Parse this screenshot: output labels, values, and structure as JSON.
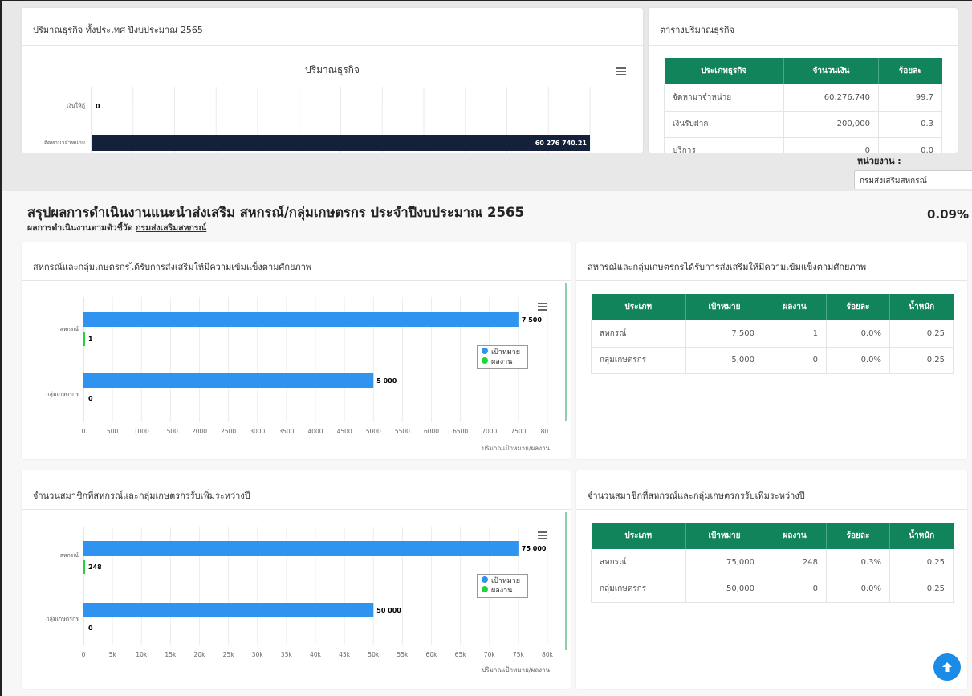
{
  "top_left_card": {
    "title": "ปริมาณธุรกิจ ทั้งประเทศ ปีงบประมาณ 2565",
    "chart_title": "ปริมาณธุรกิจ"
  },
  "top_right_card": {
    "title": "ตารางปริมาณธุรกิจ",
    "headers": [
      "ประเภทธุรกิจ",
      "จำนวนเงิน",
      "ร้อยละ"
    ],
    "rows": [
      [
        "จัดหามาจำหน่าย",
        "60,276,740",
        "99.7"
      ],
      [
        "เงินรับฝาก",
        "200,000",
        "0.3"
      ],
      [
        "บริการ",
        "0",
        "0.0"
      ]
    ]
  },
  "filter": {
    "unit_label": "หน่วยงาน :",
    "unit_value": "กรมส่งเสริมสหกรณ์"
  },
  "summary": {
    "title": "สรุปผลการดำเนินงานแนะนำส่งเสริม สหกรณ์/กลุ่มเกษตรกร ประจำปีงบประมาณ 2565",
    "subtitle_prefix": "ผลการดำเนินงานตามตัวชี้วัด",
    "subtitle_link": "กรมส่งเสริมสหกรณ์",
    "percent": "0.09%"
  },
  "section1": {
    "title_left": "สหกรณ์และกลุ่มเกษตรกรได้รับการส่งเสริมให้มีความเข้มแข็งตามศักยภาพ",
    "title_right": "สหกรณ์และกลุ่มเกษตรกรได้รับการส่งเสริมให้มีความเข้มแข็งตามศักยภาพ",
    "table_headers": [
      "ประเภท",
      "เป้าหมาย",
      "ผลงาน",
      "ร้อยละ",
      "น้ำหนัก"
    ],
    "table_rows": [
      [
        "สหกรณ์",
        "7,500",
        "1",
        "0.0%",
        "0.25"
      ],
      [
        "กลุ่มเกษตรกร",
        "5,000",
        "0",
        "0.0%",
        "0.25"
      ]
    ]
  },
  "section2": {
    "title_left": "จำนวนสมาชิกที่สหกรณ์และกลุ่มเกษตรกรรับเพิ่มระหว่างปี",
    "title_right": "จำนวนสมาชิกที่สหกรณ์และกลุ่มเกษตรกรรับเพิ่มระหว่างปี",
    "table_headers": [
      "ประเภท",
      "เป้าหมาย",
      "ผลงาน",
      "ร้อยละ",
      "น้ำหนัก"
    ],
    "table_rows": [
      [
        "สหกรณ์",
        "75,000",
        "248",
        "0.3%",
        "0.25"
      ],
      [
        "กลุ่มเกษตรกร",
        "50,000",
        "0",
        "0.0%",
        "0.25"
      ]
    ]
  },
  "chart_data": [
    {
      "type": "bar",
      "orientation": "horizontal",
      "title": "ปริมาณธุรกิจ",
      "categories": [
        "เงินให้กู้",
        "จัดหามาจำหน่าย"
      ],
      "series": [
        {
          "values": [
            0,
            60276740.21
          ]
        }
      ],
      "value_labels": [
        "0",
        "60 276 740.21"
      ],
      "color": "#15213a",
      "grid": true
    },
    {
      "type": "bar",
      "orientation": "horizontal",
      "categories": [
        "สหกรณ์",
        "กลุ่มเกษตรกร"
      ],
      "series": [
        {
          "name": "เป้าหมาย",
          "values": [
            7500,
            5000
          ],
          "value_labels": [
            "7 500",
            "5 000"
          ],
          "color": "#2f93f0"
        },
        {
          "name": "ผลงาน",
          "values": [
            1,
            0
          ],
          "value_labels": [
            "1",
            "0"
          ],
          "color": "#22d43a"
        }
      ],
      "xlim": [
        0,
        8000
      ],
      "x_ticks": [
        "0",
        "500",
        "1000",
        "1500",
        "2000",
        "2500",
        "3000",
        "3500",
        "4000",
        "4500",
        "5000",
        "5500",
        "6000",
        "6500",
        "7000",
        "7500",
        "80..."
      ],
      "xlabel": "ปริมาณเป้าหมาย/ผลงาน",
      "legend": "right",
      "grid": true
    },
    {
      "type": "bar",
      "orientation": "horizontal",
      "categories": [
        "สหกรณ์",
        "กลุ่มเกษตรกร"
      ],
      "series": [
        {
          "name": "เป้าหมาย",
          "values": [
            75000,
            50000
          ],
          "value_labels": [
            "75 000",
            "50 000"
          ],
          "color": "#2f93f0"
        },
        {
          "name": "ผลงาน",
          "values": [
            248,
            0
          ],
          "value_labels": [
            "248",
            "0"
          ],
          "color": "#22d43a"
        }
      ],
      "xlim": [
        0,
        80000
      ],
      "x_ticks": [
        "0",
        "5k",
        "10k",
        "15k",
        "20k",
        "25k",
        "30k",
        "35k",
        "40k",
        "45k",
        "50k",
        "55k",
        "60k",
        "65k",
        "70k",
        "75k",
        "80k"
      ],
      "xlabel": "ปริมาณเป้าหมาย/ผลงาน",
      "legend": "right",
      "grid": true
    }
  ]
}
